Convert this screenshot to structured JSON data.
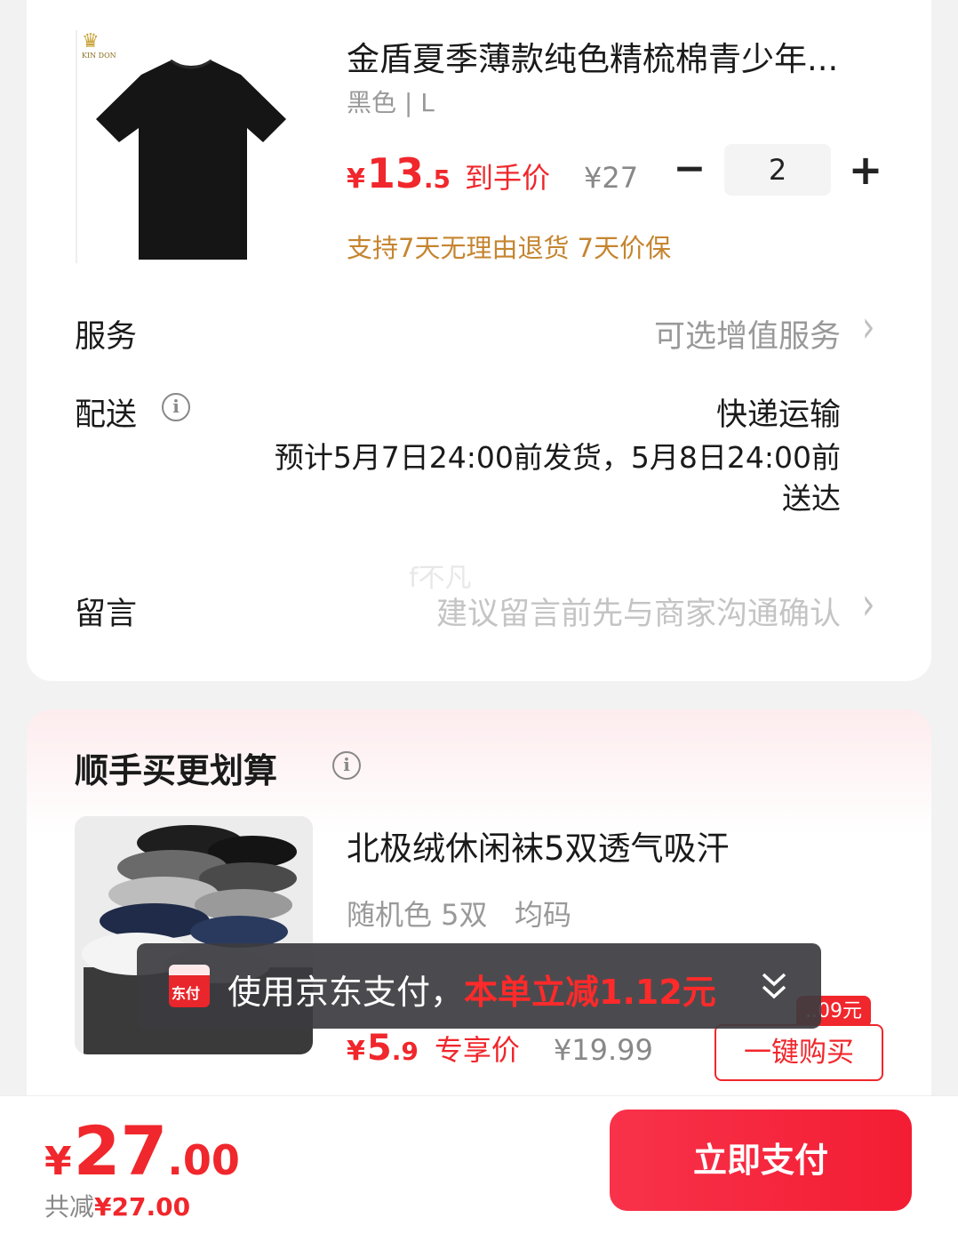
{
  "product": {
    "brand": "KIN DON",
    "title": "金盾夏季薄款纯色精梳棉青少年...",
    "spec": "黑色 | L",
    "price_yen": "¥",
    "price_int": "13",
    "price_dec": ".5",
    "price_tag": "到手价",
    "original_price": "¥27",
    "quantity": "2",
    "minus": "−",
    "plus": "+",
    "guarantee": "支持7天无理由退货 7天价保"
  },
  "service": {
    "label": "服务",
    "value": "可选增值服务"
  },
  "delivery": {
    "label": "配送",
    "method": "快递运输",
    "detail_line1": "预计5月7日24:00前发货，5月8日24:00前",
    "detail_line2": "送达"
  },
  "message": {
    "label": "留言",
    "placeholder": "建议留言前先与商家沟通确认"
  },
  "watermark": "f不凡",
  "addon": {
    "section_title": "顺手买更划算",
    "title": "北极绒休闲袜5双透气吸汗",
    "spec": "随机色 5双   均码",
    "price_yen": "¥",
    "price_int": "5",
    "price_dec": ".9",
    "price_tag": "专享价",
    "original_price": "¥19.99",
    "badge": "..09元",
    "buy_label": "一键购买"
  },
  "toast": {
    "logo_text": "东付",
    "text": "使用京东支付，",
    "highlight": "本单立减1.12元"
  },
  "footer": {
    "total_yen": "¥",
    "total_int": "27",
    "total_dec": ".00",
    "saved_label": "共减",
    "saved_amount": "¥27.00",
    "pay_label": "立即支付"
  },
  "colors": {
    "accent": "#f0272c",
    "guarantee": "#c58530"
  },
  "icons": [
    "info-icon",
    "chevron-right-icon",
    "chevron-double-down-icon"
  ]
}
